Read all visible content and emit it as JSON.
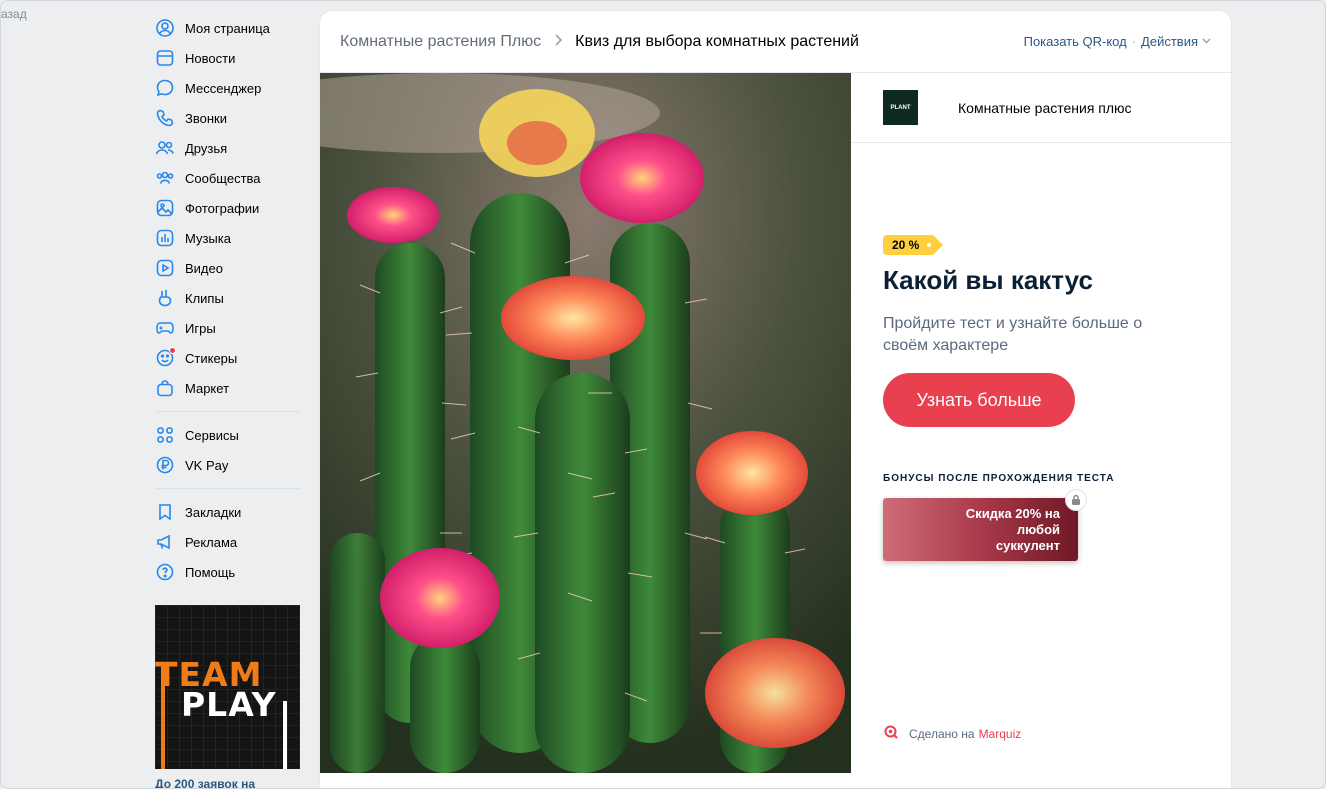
{
  "back_link": "азад",
  "sidebar": {
    "items": [
      {
        "label": "Моя страница",
        "icon": "user-circle-icon"
      },
      {
        "label": "Новости",
        "icon": "news-icon"
      },
      {
        "label": "Мессенджер",
        "icon": "message-icon"
      },
      {
        "label": "Звонки",
        "icon": "phone-icon"
      },
      {
        "label": "Друзья",
        "icon": "friends-icon"
      },
      {
        "label": "Сообщества",
        "icon": "communities-icon"
      },
      {
        "label": "Фотографии",
        "icon": "photo-icon"
      },
      {
        "label": "Музыка",
        "icon": "music-icon"
      },
      {
        "label": "Видео",
        "icon": "video-icon"
      },
      {
        "label": "Клипы",
        "icon": "clips-icon"
      },
      {
        "label": "Игры",
        "icon": "gamepad-icon"
      },
      {
        "label": "Стикеры",
        "icon": "sticker-icon"
      },
      {
        "label": "Маркет",
        "icon": "bag-icon"
      }
    ],
    "items2": [
      {
        "label": "Сервисы",
        "icon": "grid-icon"
      },
      {
        "label": "VK Pay",
        "icon": "ruble-icon"
      }
    ],
    "items3": [
      {
        "label": "Закладки",
        "icon": "bookmark-icon"
      },
      {
        "label": "Реклама",
        "icon": "megaphone-icon"
      },
      {
        "label": "Помощь",
        "icon": "help-icon"
      }
    ],
    "promo": {
      "line1": "TEAM",
      "line2": "PLAY",
      "caption": "До 200 заявок на"
    }
  },
  "header": {
    "crumb_group": "Комнатные растения Плюс",
    "crumb_current": "Квиз для выбора комнатных растений",
    "qr_label": "Показать QR-код",
    "actions_label": "Действия"
  },
  "quiz": {
    "brand_logo_text": "PLANT",
    "brand_name": "Комнатные растения плюс",
    "badge": "20 %",
    "title": "Какой вы кактус",
    "subtitle": "Пройдите тест и узнайте больше о своём характере",
    "cta": "Узнать больше",
    "bonus_heading": "БОНУСЫ ПОСЛЕ ПРОХОЖДЕНИЯ ТЕСТА",
    "bonus_text": "Скидка 20% на любой суккулент",
    "made_with": "Сделано на",
    "made_with_brand": "Marquiz"
  },
  "colors": {
    "accent": "#e8404f",
    "link": "#2a5885",
    "badge": "#ffcf3e",
    "promo_orange": "#f07c17"
  }
}
